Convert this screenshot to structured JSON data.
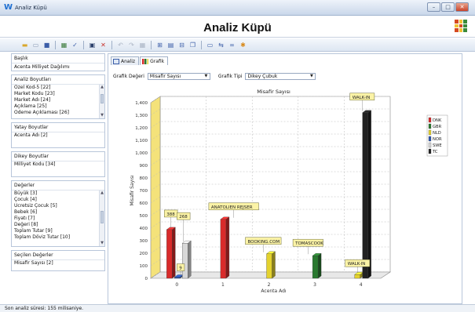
{
  "window": {
    "title": "Analiz Küpü",
    "controls": {
      "minimize": "–",
      "maximize": "□",
      "close": "✕"
    }
  },
  "header": {
    "title": "Analiz Küpü"
  },
  "toolbar": {
    "icons": [
      "folder-open-icon",
      "new-document-icon",
      "save-icon",
      "chart-refresh-icon",
      "filter-icon",
      "window-icon",
      "close-red-icon",
      "undo-icon",
      "redo-icon",
      "grid-icon",
      "export-icon",
      "layout-icon",
      "print-icon",
      "copy-icon",
      "sort-icon",
      "swap-icon",
      "star-icon"
    ]
  },
  "sidebar": {
    "baslik": {
      "label": "Başlık",
      "value": "Acenta Milliyet Dağılımı"
    },
    "analiz_boyutlari": {
      "label": "Analiz Boyutları",
      "items": [
        "Özel Kod-5 [22]",
        "Market Kodu [23]",
        "Market Adı [24]",
        "Açıklama [25]",
        "Ödeme Açıklaması [26]"
      ]
    },
    "yatay_boyutlar": {
      "label": "Yatay Boyutlar",
      "items": [
        "Acenta Adı [2]"
      ]
    },
    "dikey_boyutlar": {
      "label": "Dikey Boyutlar",
      "items": [
        "Milliyet Kodu [34]"
      ]
    },
    "degerler": {
      "label": "Değerler",
      "items": [
        "Büyük [3]",
        "Çocuk [4]",
        "Ücretsiz Çocuk [5]",
        "Bebek [6]",
        "Fiyatı [7]",
        "Değeri [8]",
        "Toplam Tutar [9]",
        "Toplam Döviz Tutar [10]"
      ]
    },
    "secilen_degerler": {
      "label": "Seçilen Değerler",
      "items": [
        "Misafir Sayısı [2]"
      ]
    }
  },
  "tabs": [
    {
      "label": "Analiz",
      "active": false
    },
    {
      "label": "Grafik",
      "active": true
    }
  ],
  "controls": {
    "grafik_degeri_label": "Grafik Değeri",
    "grafik_degeri_value": "Misafir Sayısı",
    "grafik_tipi_label": "Grafik Tipi",
    "grafik_tipi_value": "Dikey Çubuk"
  },
  "chart_data": {
    "type": "bar",
    "title": "Misafir Sayısı",
    "xlabel": "Acenta Adı",
    "ylabel": "Misafir Sayısı",
    "ylim": [
      0,
      1400
    ],
    "y_ticks": [
      0,
      100,
      200,
      300,
      400,
      500,
      600,
      700,
      800,
      900,
      1000,
      1100,
      1200,
      1300,
      1400
    ],
    "categories": [
      "0",
      "1",
      "2",
      "3",
      "4"
    ],
    "series": [
      {
        "name": "DNK",
        "color": "#d92b2b",
        "values": [
          388,
          470,
          0,
          0,
          0
        ]
      },
      {
        "name": "GBR",
        "color": "#2a7a30",
        "values": [
          0,
          0,
          0,
          180,
          0
        ]
      },
      {
        "name": "NLD",
        "color": "#e4d22e",
        "values": [
          0,
          0,
          195,
          0,
          30
        ]
      },
      {
        "name": "NOR",
        "color": "#2a55b0",
        "values": [
          9,
          0,
          0,
          0,
          0
        ]
      },
      {
        "name": "SWE",
        "color": "#d8d8d8",
        "values": [
          280,
          0,
          0,
          0,
          0
        ]
      },
      {
        "name": "TC",
        "color": "#222222",
        "values": [
          0,
          0,
          0,
          0,
          1320
        ]
      }
    ],
    "annotations": [
      {
        "text": "388",
        "category": 0,
        "value": 388
      },
      {
        "text": "268",
        "category": 0,
        "value": 280
      },
      {
        "text": "9",
        "category": 0,
        "value": 9
      },
      {
        "text": "ANATOLIEN REJSER",
        "category": 1,
        "value": 470
      },
      {
        "text": "BOOKING.COM",
        "category": 2,
        "value": 195
      },
      {
        "text": "TOMASCOOK",
        "category": 3,
        "value": 180
      },
      {
        "text": "WALK-IN",
        "category": 4,
        "value": 30
      },
      {
        "text": "WALK-IN",
        "category": 4,
        "value": 1320
      }
    ],
    "legend_position": "right",
    "grid": true
  },
  "status": {
    "text": "Son analiz süresi: 155 milisaniye."
  }
}
